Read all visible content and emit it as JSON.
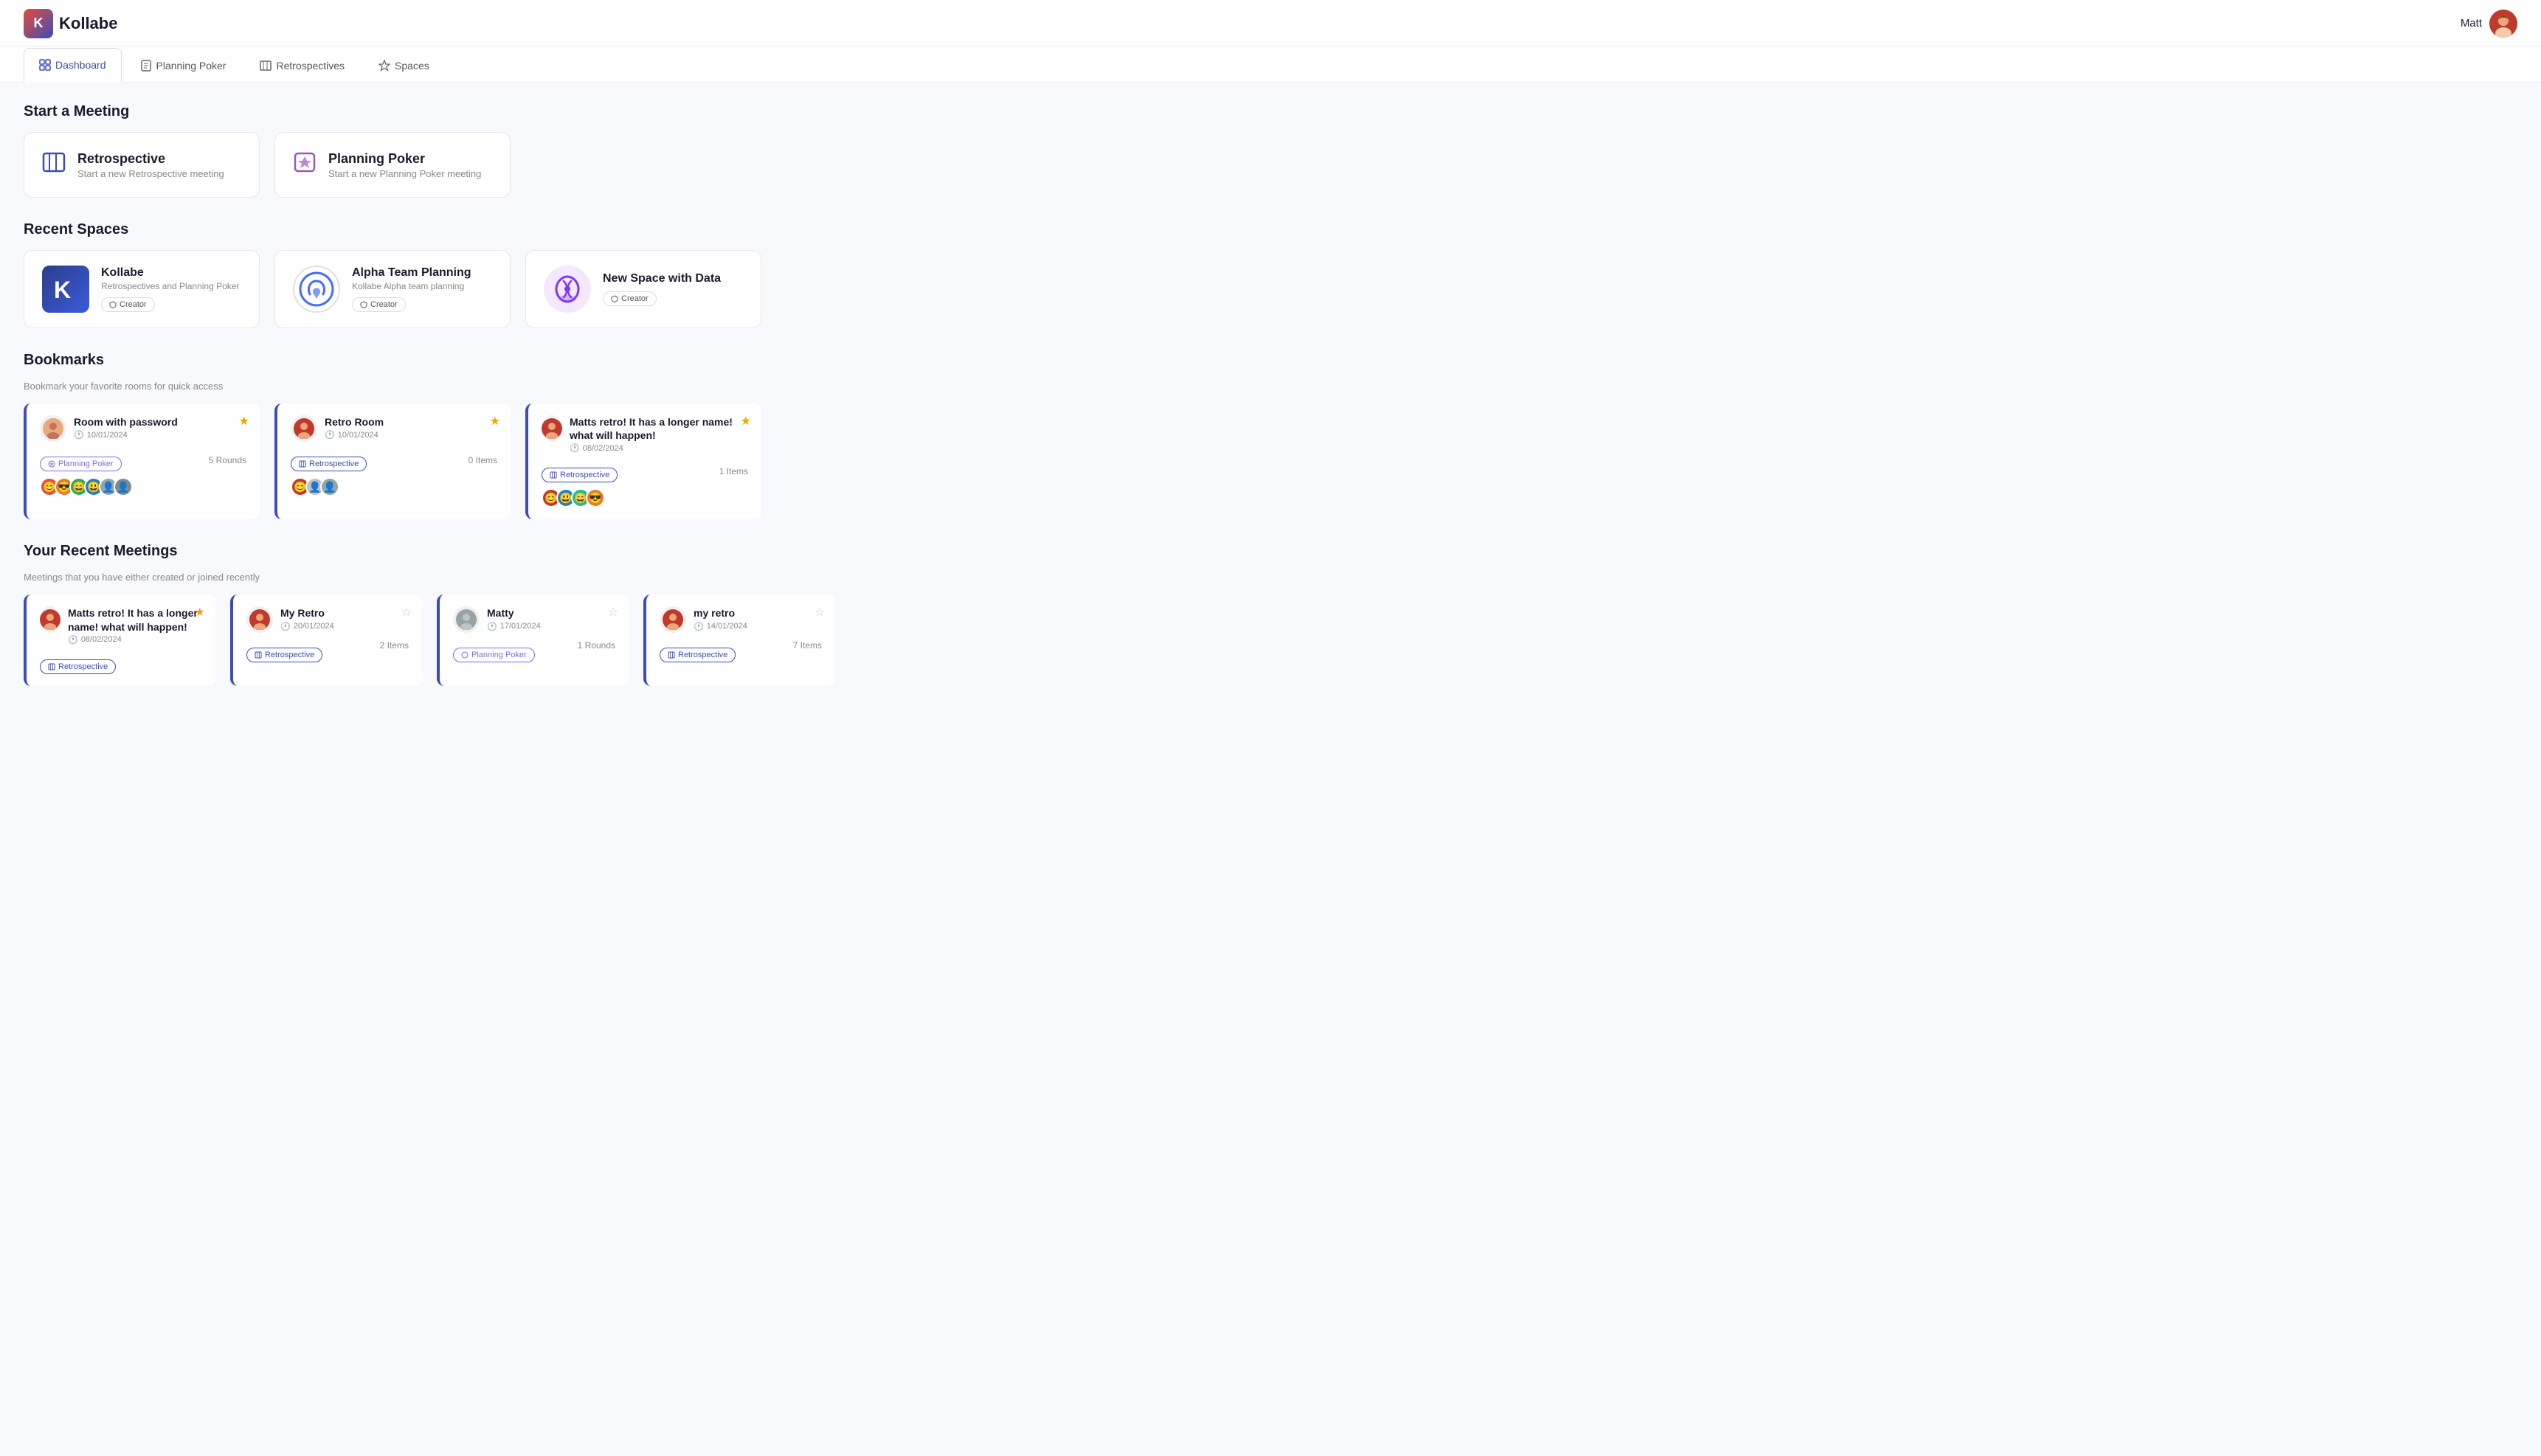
{
  "app": {
    "name": "Kollabe",
    "user": "Matt"
  },
  "nav": {
    "tabs": [
      {
        "id": "dashboard",
        "label": "Dashboard",
        "active": true
      },
      {
        "id": "planning-poker",
        "label": "Planning Poker",
        "active": false
      },
      {
        "id": "retrospectives",
        "label": "Retrospectives",
        "active": false
      },
      {
        "id": "spaces",
        "label": "Spaces",
        "active": false
      }
    ]
  },
  "start_meeting": {
    "section_title": "Start a Meeting",
    "cards": [
      {
        "id": "retrospective",
        "title": "Retrospective",
        "subtitle": "Start a new Retrospective meeting"
      },
      {
        "id": "planning-poker",
        "title": "Planning Poker",
        "subtitle": "Start a new Planning Poker meeting"
      }
    ]
  },
  "recent_spaces": {
    "section_title": "Recent Spaces",
    "spaces": [
      {
        "id": "kollabe",
        "name": "Kollabe",
        "description": "Retrospectives and Planning Poker",
        "role": "Creator"
      },
      {
        "id": "alpha-team",
        "name": "Alpha Team Planning",
        "description": "Kollabe Alpha team planning",
        "role": "Creator"
      },
      {
        "id": "new-space",
        "name": "New Space with Data",
        "description": "",
        "role": "Creator"
      }
    ]
  },
  "bookmarks": {
    "section_title": "Bookmarks",
    "subtitle": "Bookmark your favorite rooms for quick access",
    "cards": [
      {
        "id": "room-password",
        "title": "Room with password",
        "date": "10/01/2024",
        "type": "Planning Poker",
        "type_id": "poker",
        "count": "5 Rounds",
        "starred": true
      },
      {
        "id": "retro-room",
        "title": "Retro Room",
        "date": "10/01/2024",
        "type": "Retrospective",
        "type_id": "retro",
        "count": "0 Items",
        "starred": true
      },
      {
        "id": "matts-retro",
        "title": "Matts retro! It has a longer name! what will happen!",
        "date": "08/02/2024",
        "type": "Retrospective",
        "type_id": "retro",
        "count": "1 Items",
        "starred": true
      }
    ]
  },
  "recent_meetings": {
    "section_title": "Your Recent Meetings",
    "subtitle": "Meetings that you have either created or joined recently",
    "items": [
      {
        "id": "matts-retro-2",
        "title": "Matts retro! It has a longer name! what will happen!",
        "date": "08/02/2024",
        "type": "Retrospective",
        "type_id": "retro",
        "starred": true
      },
      {
        "id": "my-retro",
        "title": "My Retro",
        "date": "20/01/2024",
        "type": "Retrospective",
        "type_id": "retro",
        "count": "2 Items",
        "starred": false
      },
      {
        "id": "matty",
        "title": "Matty",
        "date": "17/01/2024",
        "type": "Planning Poker",
        "type_id": "poker",
        "count": "1 Rounds",
        "starred": false
      },
      {
        "id": "my-retro-2",
        "title": "my retro",
        "date": "14/01/2024",
        "type": "Retrospective",
        "type_id": "retro",
        "count": "7 Items",
        "starred": false
      }
    ]
  },
  "icons": {
    "retro": "▦",
    "poker": "🃏",
    "clock": "🕐",
    "shield": "🛡",
    "star_filled": "★",
    "star_empty": "☆"
  }
}
